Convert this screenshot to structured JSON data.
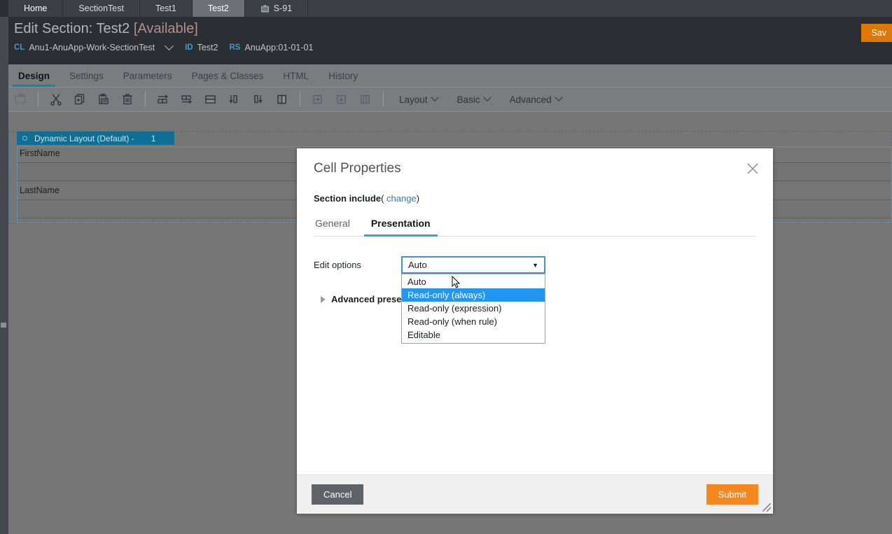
{
  "browser_tabs": [
    {
      "label": "Home",
      "icon": "",
      "active": false
    },
    {
      "label": "SectionTest",
      "icon": "",
      "active": false
    },
    {
      "label": "Test1",
      "icon": "",
      "active": false
    },
    {
      "label": "Test2",
      "icon": "",
      "active": true
    },
    {
      "label": "S-91",
      "icon": "briefcase-icon",
      "active": false
    }
  ],
  "header": {
    "title_prefix": "Edit Section: Test2 ",
    "title_status": "[Available]",
    "meta": [
      {
        "key": "CL",
        "value": "Anu1-AnuApp-Work-SectionTest",
        "has_caret": true
      },
      {
        "key": "ID",
        "value": "Test2",
        "has_caret": false
      },
      {
        "key": "RS",
        "value": "AnuApp:01-01-01",
        "has_caret": false
      }
    ],
    "save_label": "Sav"
  },
  "nav_tabs": [
    {
      "label": "Design",
      "active": true
    },
    {
      "label": "Settings",
      "active": false
    },
    {
      "label": "Parameters",
      "active": false
    },
    {
      "label": "Pages & Classes",
      "active": false
    },
    {
      "label": "HTML",
      "active": false
    },
    {
      "label": "History",
      "active": false
    }
  ],
  "toolbar": {
    "icons": [
      {
        "name": "select-cell-icon",
        "disabled": true
      },
      {
        "name": "cut-icon",
        "disabled": false
      },
      {
        "name": "copy-icon",
        "disabled": false
      },
      {
        "name": "paste-icon",
        "disabled": false
      },
      {
        "name": "delete-trash-icon",
        "disabled": false
      },
      {
        "name": "insert-column-right-icon",
        "disabled": false
      },
      {
        "name": "merge-cells-right-icon",
        "disabled": false
      },
      {
        "name": "split-row-icon",
        "disabled": false
      },
      {
        "name": "move-down-left-icon",
        "disabled": false
      },
      {
        "name": "move-down-right-icon",
        "disabled": false
      },
      {
        "name": "split-column-icon",
        "disabled": false
      },
      {
        "name": "insert-right-icon",
        "disabled": false
      },
      {
        "name": "insert-below-icon",
        "disabled": false
      },
      {
        "name": "columns-icon",
        "disabled": false
      }
    ],
    "menus": [
      {
        "label": "Layout"
      },
      {
        "label": "Basic"
      },
      {
        "label": "Advanced"
      }
    ]
  },
  "canvas": {
    "dynamic_layout_label": "Dynamic Layout (Default) -",
    "dynamic_layout_number": "1",
    "fields": [
      {
        "label": "FirstName"
      },
      {
        "label": "LastName"
      }
    ]
  },
  "modal": {
    "title": "Cell Properties",
    "close_icon": "close-icon",
    "section_include_label": "Section include",
    "section_include_paren_open": "(",
    "section_include_change": "change",
    "section_include_paren_close": ")",
    "subtabs": [
      {
        "label": "General",
        "active": false
      },
      {
        "label": "Presentation",
        "active": true
      }
    ],
    "edit_options": {
      "label": "Edit options",
      "selected": "Auto",
      "open": true,
      "options": [
        {
          "label": "Auto",
          "highlighted": false
        },
        {
          "label": "Read-only (always)",
          "highlighted": true
        },
        {
          "label": "Read-only (expression)",
          "highlighted": false
        },
        {
          "label": "Read-only (when rule)",
          "highlighted": false
        },
        {
          "label": "Editable",
          "highlighted": false
        }
      ]
    },
    "advanced_presentation_label": "Advanced presentation",
    "cancel_label": "Cancel",
    "submit_label": "Submit"
  },
  "colors": {
    "accent_blue": "#2196f3",
    "tab_underline_blue": "#1b7fb5",
    "submit_orange": "#f6871f",
    "save_orange": "#e07800",
    "layout_header_teal": "#0f6e93",
    "canvas_gray": "#767676",
    "header_dark": "#2b2e33"
  }
}
